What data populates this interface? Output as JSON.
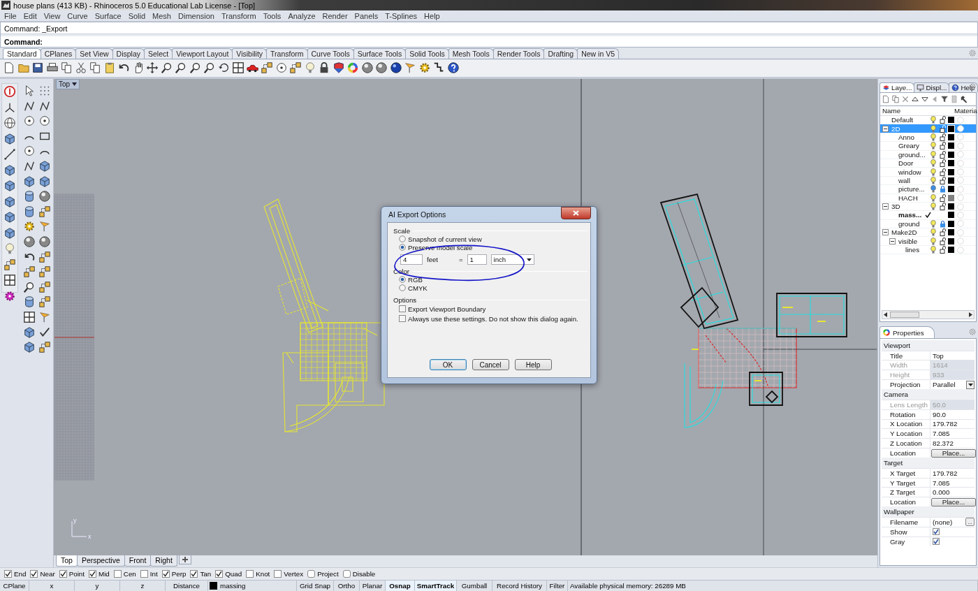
{
  "window": {
    "title": "house plans (413 KB) - Rhinoceros 5.0 Educational Lab License - [Top]"
  },
  "menu": [
    "File",
    "Edit",
    "View",
    "Curve",
    "Surface",
    "Solid",
    "Mesh",
    "Dimension",
    "Transform",
    "Tools",
    "Analyze",
    "Render",
    "Panels",
    "T-Splines",
    "Help"
  ],
  "command": {
    "history": "Command: _Export",
    "prompt": "Command:"
  },
  "toolbar_tabs": [
    {
      "label": "Standard",
      "selected": true
    },
    {
      "label": "CPlanes",
      "selected": false
    },
    {
      "label": "Set View",
      "selected": false
    },
    {
      "label": "Display",
      "selected": false
    },
    {
      "label": "Select",
      "selected": false
    },
    {
      "label": "Viewport Layout",
      "selected": false
    },
    {
      "label": "Visibility",
      "selected": false
    },
    {
      "label": "Transform",
      "selected": false
    },
    {
      "label": "Curve Tools",
      "selected": false
    },
    {
      "label": "Surface Tools",
      "selected": false
    },
    {
      "label": "Solid Tools",
      "selected": false
    },
    {
      "label": "Mesh Tools",
      "selected": false
    },
    {
      "label": "Render Tools",
      "selected": false
    },
    {
      "label": "Drafting",
      "selected": false
    },
    {
      "label": "New in V5",
      "selected": false
    }
  ],
  "viewport": {
    "title": "Top",
    "axis_labels": {
      "y": "y",
      "x": "x"
    },
    "tabs": [
      {
        "label": "Top",
        "selected": true
      },
      {
        "label": "Perspective",
        "selected": false
      },
      {
        "label": "Front",
        "selected": false
      },
      {
        "label": "Right",
        "selected": false
      }
    ]
  },
  "dialog": {
    "title": "AI Export Options",
    "scale": {
      "heading": "Scale",
      "options": [
        {
          "label": "Snapshot of current view",
          "selected": false
        },
        {
          "label": "Preserve model scale",
          "selected": true
        }
      ],
      "model_value": "4",
      "model_unit": "feet",
      "equals": "=",
      "paper_value": "1",
      "paper_unit": "inch"
    },
    "color": {
      "heading": "Color",
      "options": [
        {
          "label": "RGB",
          "selected": true
        },
        {
          "label": "CMYK",
          "selected": false
        }
      ]
    },
    "options": {
      "heading": "Options",
      "checks": [
        {
          "label": "Export Viewport Boundary",
          "checked": false
        },
        {
          "label": "Always use these settings. Do not show this dialog again.",
          "checked": false
        }
      ]
    },
    "buttons": [
      {
        "label": "OK",
        "default": true
      },
      {
        "label": "Cancel",
        "default": false
      },
      {
        "label": "Help",
        "default": false
      }
    ]
  },
  "layers": {
    "tabs": [
      {
        "label": "Laye...",
        "selected": true
      },
      {
        "label": "Displ...",
        "selected": false
      },
      {
        "label": "Help",
        "selected": false
      }
    ],
    "columns": [
      "Name",
      "Materia"
    ],
    "rows": [
      {
        "name": "Default",
        "selected": false,
        "current": false,
        "lit": true,
        "locked": false,
        "color": "#000000"
      },
      {
        "name": "2D",
        "selected": true,
        "current": false,
        "lit": true,
        "locked": false,
        "color": "#000000",
        "expanded": true,
        "children": [
          {
            "name": "Anno",
            "selected": false,
            "current": false,
            "lit": true,
            "locked": false,
            "color": "#000000"
          },
          {
            "name": "Greary",
            "selected": false,
            "current": false,
            "lit": true,
            "locked": false,
            "color": "#000000"
          },
          {
            "name": "ground...",
            "selected": false,
            "current": false,
            "lit": true,
            "locked": false,
            "color": "#000000"
          },
          {
            "name": "Door",
            "selected": false,
            "current": false,
            "lit": true,
            "locked": false,
            "color": "#000000"
          },
          {
            "name": "window",
            "selected": false,
            "current": false,
            "lit": true,
            "locked": false,
            "color": "#000000"
          },
          {
            "name": "wall",
            "selected": false,
            "current": false,
            "lit": true,
            "locked": false,
            "color": "#000000"
          },
          {
            "name": "picture...",
            "selected": false,
            "current": false,
            "lit": false,
            "locked": true,
            "color": "#000000"
          },
          {
            "name": "HACH",
            "selected": false,
            "current": false,
            "lit": true,
            "locked": false,
            "color": "#808080"
          }
        ]
      },
      {
        "name": "3D",
        "selected": false,
        "current": false,
        "lit": true,
        "locked": false,
        "color": "#000000",
        "expanded": true,
        "children": [
          {
            "name": "mass...",
            "selected": false,
            "current": true,
            "color": "#000000"
          },
          {
            "name": "ground",
            "selected": false,
            "current": false,
            "lit": true,
            "locked": true,
            "color": "#000000"
          }
        ]
      },
      {
        "name": "Make2D",
        "selected": false,
        "current": false,
        "lit": true,
        "locked": false,
        "color": "#000000",
        "expanded": true,
        "children": [
          {
            "name": "visible",
            "selected": false,
            "current": false,
            "lit": true,
            "locked": false,
            "color": "#000000",
            "expanded": true,
            "children": [
              {
                "name": "lines",
                "selected": false,
                "current": false,
                "lit": true,
                "locked": false,
                "color": "#000000"
              }
            ]
          }
        ]
      }
    ]
  },
  "properties": {
    "tab": "Properties",
    "sections": [
      {
        "title": "Viewport",
        "rows": [
          {
            "label": "Title",
            "value": "Top",
            "kind": "text",
            "disabled": false
          },
          {
            "label": "Width",
            "value": "1614",
            "kind": "text",
            "disabled": true
          },
          {
            "label": "Height",
            "value": "933",
            "kind": "text",
            "disabled": true
          },
          {
            "label": "Projection",
            "value": "Parallel",
            "kind": "dropdown",
            "disabled": false
          }
        ]
      },
      {
        "title": "Camera",
        "rows": [
          {
            "label": "Lens Length",
            "value": "50.0",
            "kind": "text",
            "disabled": true
          },
          {
            "label": "Rotation",
            "value": "90.0",
            "kind": "text",
            "disabled": false
          },
          {
            "label": "X Location",
            "value": "179.782",
            "kind": "text",
            "disabled": false
          },
          {
            "label": "Y Location",
            "value": "7.085",
            "kind": "text",
            "disabled": false
          },
          {
            "label": "Z Location",
            "value": "82.372",
            "kind": "text",
            "disabled": false
          },
          {
            "label": "Location",
            "value": "Place...",
            "kind": "button",
            "disabled": false
          }
        ]
      },
      {
        "title": "Target",
        "rows": [
          {
            "label": "X Target",
            "value": "179.782",
            "kind": "text",
            "disabled": false
          },
          {
            "label": "Y Target",
            "value": "7.085",
            "kind": "text",
            "disabled": false
          },
          {
            "label": "Z Target",
            "value": "0.000",
            "kind": "text",
            "disabled": false
          },
          {
            "label": "Location",
            "value": "Place...",
            "kind": "button",
            "disabled": false
          }
        ]
      },
      {
        "title": "Wallpaper",
        "rows": [
          {
            "label": "Filename",
            "value": "(none)",
            "kind": "file",
            "button": "...",
            "disabled": false
          },
          {
            "label": "Show",
            "kind": "checkbox",
            "checked": true,
            "disabled": false
          },
          {
            "label": "Gray",
            "kind": "checkbox",
            "checked": true,
            "disabled": false
          }
        ]
      }
    ]
  },
  "osnap": [
    {
      "label": "End",
      "checked": true
    },
    {
      "label": "Near",
      "checked": true
    },
    {
      "label": "Point",
      "checked": true
    },
    {
      "label": "Mid",
      "checked": true
    },
    {
      "label": "Cen",
      "checked": false
    },
    {
      "label": "Int",
      "checked": false
    },
    {
      "label": "Perp",
      "checked": true
    },
    {
      "label": "Tan",
      "checked": true
    },
    {
      "label": "Quad",
      "checked": true
    },
    {
      "label": "Knot",
      "checked": false
    },
    {
      "label": "Vertex",
      "checked": false
    },
    {
      "label": "Project",
      "checked": false
    },
    {
      "label": "Disable",
      "checked": false
    }
  ],
  "status": {
    "cells": [
      {
        "kind": "text",
        "label": "CPlane"
      },
      {
        "kind": "text",
        "label": "x"
      },
      {
        "kind": "text",
        "label": "y"
      },
      {
        "kind": "text",
        "label": "z"
      },
      {
        "kind": "text",
        "label": "Distance"
      },
      {
        "kind": "layer",
        "label": "massing",
        "color": "#000000"
      },
      {
        "kind": "toggle",
        "label": "Grid Snap",
        "on": false
      },
      {
        "kind": "toggle",
        "label": "Ortho",
        "on": false
      },
      {
        "kind": "toggle",
        "label": "Planar",
        "on": false
      },
      {
        "kind": "toggle",
        "label": "Osnap",
        "on": true
      },
      {
        "kind": "toggle",
        "label": "SmartTrack",
        "on": true
      },
      {
        "kind": "toggle",
        "label": "Gumball",
        "on": false
      },
      {
        "kind": "toggle",
        "label": "Record History",
        "on": false
      },
      {
        "kind": "toggle",
        "label": "Filter",
        "on": false
      },
      {
        "kind": "text",
        "label": "Available physical memory: 26289 MB"
      }
    ]
  }
}
